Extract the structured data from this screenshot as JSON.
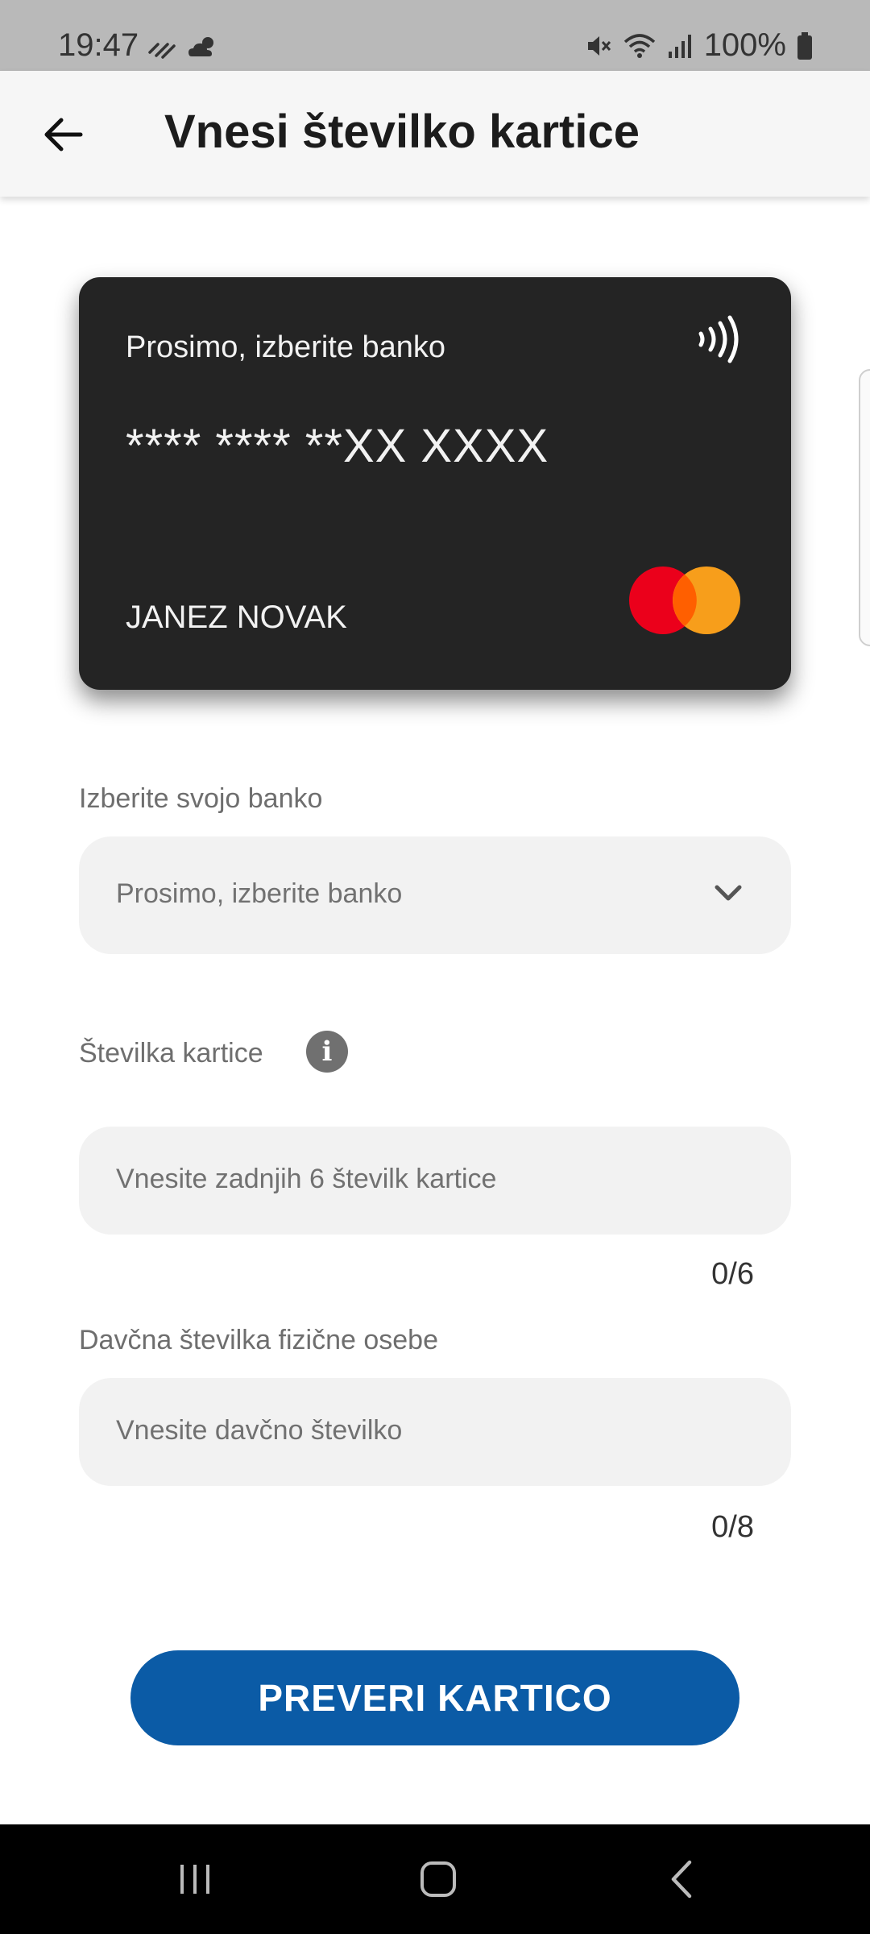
{
  "status_bar": {
    "time": "19:47",
    "battery": "100%",
    "icons": [
      "notification-icon",
      "weather-icon",
      "mute-icon",
      "wifi-icon",
      "signal-icon",
      "battery-icon"
    ]
  },
  "header": {
    "title": "Vnesi številko kartice",
    "back_icon": "arrow-left-icon"
  },
  "card": {
    "bank_name": "Prosimo, izberite banko",
    "number": "**** **** **XX XXXX",
    "holder": "JANEZ NOVAK",
    "network": "mastercard-logo",
    "contactless_icon": "nfc-icon",
    "colors": {
      "background": "#242424",
      "mc_red": "#eb001b",
      "mc_orange": "#f79e1b"
    }
  },
  "form": {
    "bank": {
      "label": "Izberite svojo banko",
      "selected": "Prosimo, izberite banko"
    },
    "card_number": {
      "label": "Številka kartice",
      "placeholder": "Vnesite zadnjih 6 številk kartice",
      "counter": "0/6",
      "info_icon": "i"
    },
    "tax_number": {
      "label": "Davčna številka fizične osebe",
      "placeholder": "Vnesite davčno številko",
      "counter": "0/8"
    }
  },
  "actions": {
    "submit_label": "PREVERI KARTICO",
    "accent": "#0b5ba6"
  },
  "nav_bar": {
    "buttons": [
      "recent-apps-icon",
      "home-icon",
      "back-icon"
    ]
  }
}
